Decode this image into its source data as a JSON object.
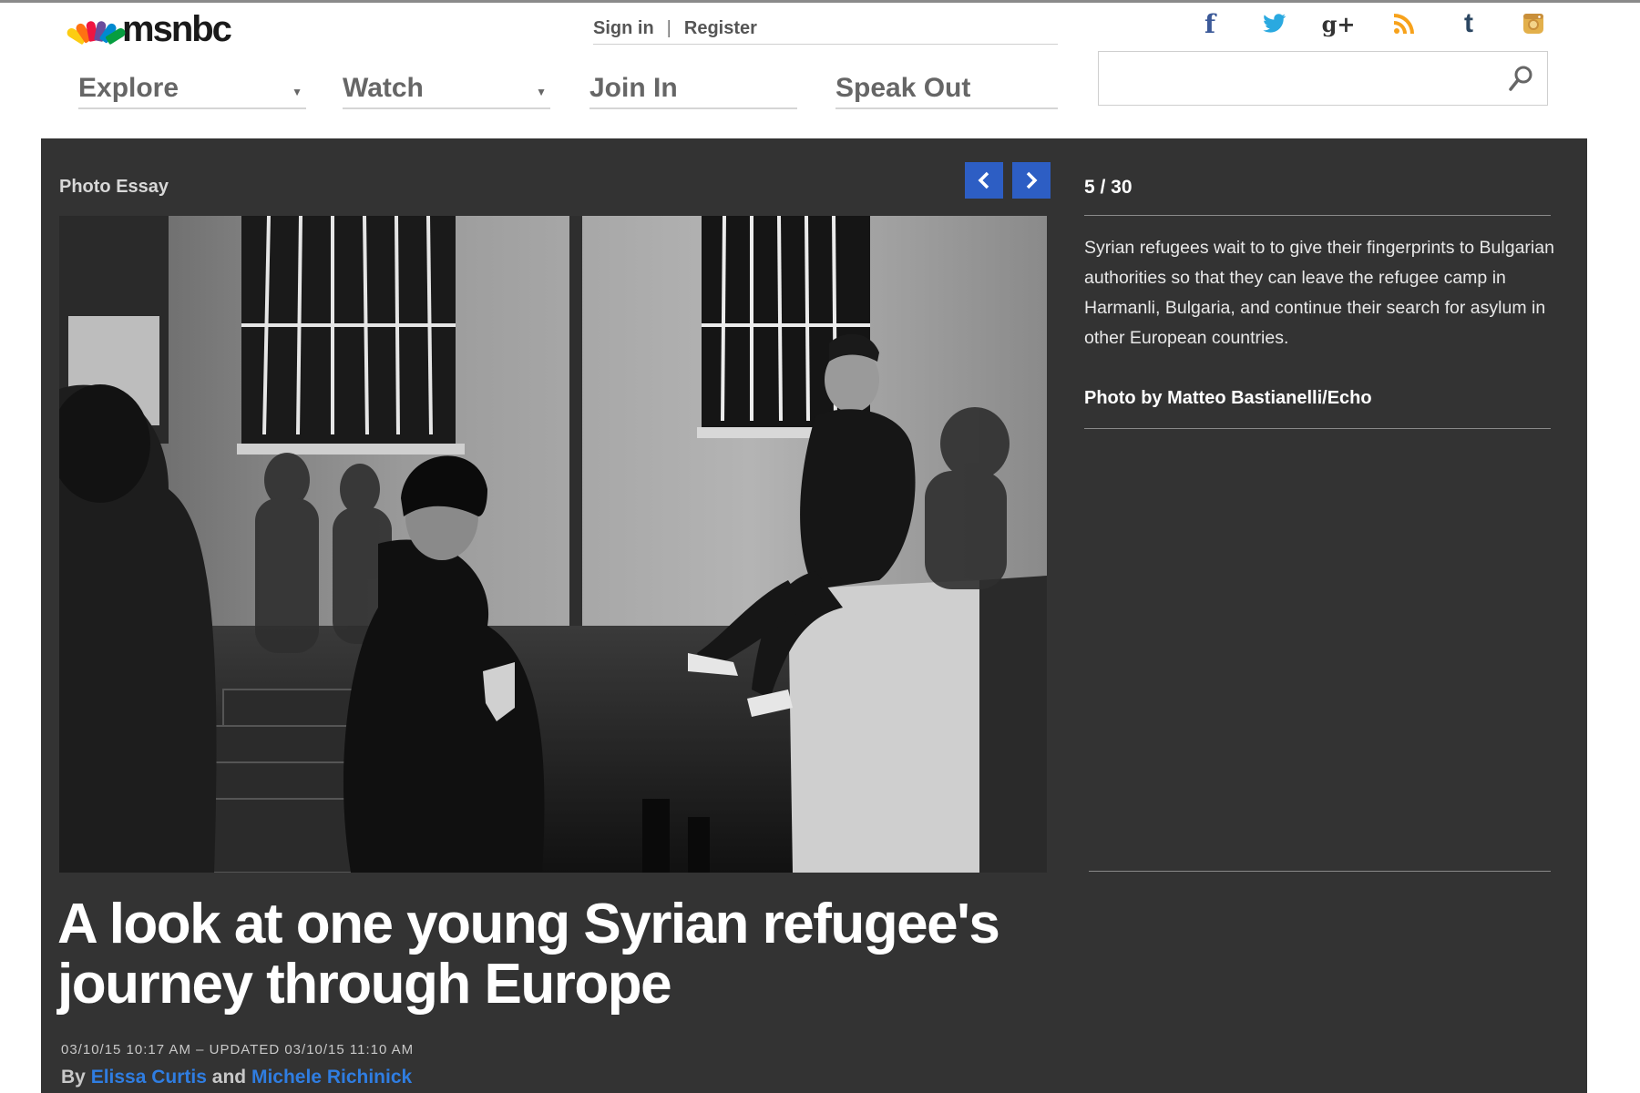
{
  "brand": {
    "name": "msnbc",
    "peacock_colors": [
      "#fccc12",
      "#ef1541",
      "#ff7112",
      "#6a4c9c",
      "#0089d0",
      "#069e40"
    ]
  },
  "account": {
    "sign_in": "Sign in",
    "separator": "|",
    "register": "Register"
  },
  "social": {
    "icons": [
      "facebook-icon",
      "twitter-icon",
      "google-plus-icon",
      "rss-icon",
      "tumblr-icon",
      "instagram-icon"
    ],
    "glyphs": {
      "facebook": "f",
      "google_plus": "g+",
      "tumblr": "t"
    },
    "colors": {
      "facebook": "#3b5998",
      "twitter": "#2aa9e0",
      "google_plus": "#333333",
      "rss": "#f7a21b",
      "tumblr": "#2c4762",
      "instagram": "#e3b04b"
    }
  },
  "nav": {
    "explore": "Explore",
    "watch": "Watch",
    "join_in": "Join In",
    "speak_out": "Speak Out"
  },
  "search": {
    "value": "",
    "placeholder": ""
  },
  "gallery": {
    "section_label": "Photo Essay",
    "counter": "5 / 30",
    "caption": "Syrian refugees wait to to give their fingerprints to Bulgarian authorities so that they can leave the refugee camp in Harmanli, Bulgaria, and continue their search for asylum in other European countries.",
    "credit": "Photo by Matteo Bastianelli/Echo",
    "accent_color": "#2d5ec4"
  },
  "article": {
    "headline": "A look at one young Syrian refugee's journey through Europe",
    "dateline": "03/10/15 10:17 AM – UPDATED 03/10/15 11:10 AM",
    "byline_prefix": "By",
    "author1": "Elissa Curtis",
    "byline_join": "and",
    "author2": "Michele Richinick",
    "link_color": "#2f7de1"
  }
}
